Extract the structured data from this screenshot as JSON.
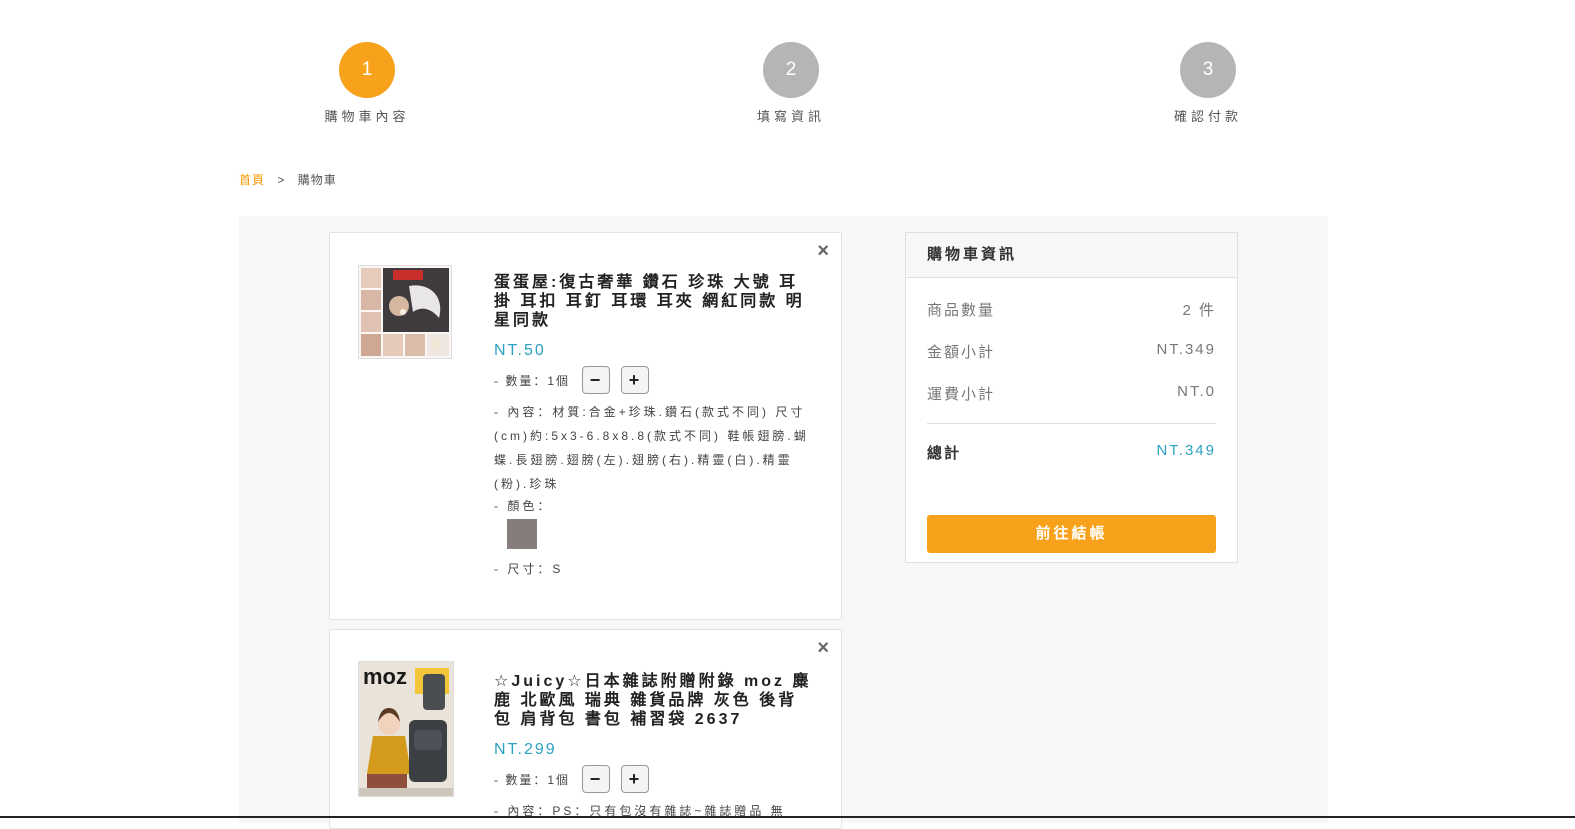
{
  "steps": [
    {
      "number": "1",
      "label": "購物車內容",
      "active": true
    },
    {
      "number": "2",
      "label": "填寫資訊",
      "active": false
    },
    {
      "number": "3",
      "label": "確認付款",
      "active": false
    }
  ],
  "breadcrumb": {
    "home": "首頁",
    "separator": ">",
    "current": "購物車"
  },
  "items": [
    {
      "close": "×",
      "title": "蛋蛋屋:復古奢華 鑽石 珍珠 大號 耳掛 耳扣 耳釘 耳環 耳夾 網紅同款 明星同款",
      "price": "NT.50",
      "qty_label": "- 數量：1個",
      "minus": "−",
      "plus": "+",
      "content": "- 內容：材質:合金+珍珠.鑽石(款式不同) 尺寸(cm)約:5x3-6.8x8.8(款式不同) 鞋帳翅膀.蝴蝶.長翅膀.翅膀(左).翅膀(右).精靈(白).精靈(粉).珍珠",
      "color_label": "- 顏色：",
      "color_swatch": "#857c7b",
      "size_label": "- 尺寸：S",
      "image_alt": "蛋蛋屋"
    },
    {
      "close": "×",
      "title": "☆Juicy☆日本雜誌附贈附錄 moz 麋鹿 北歐風 瑞典 雜貨品牌 灰色 後背包 肩背包 書包 補習袋 2637",
      "price": "NT.299",
      "qty_label": "- 數量：1個",
      "minus": "−",
      "plus": "+",
      "content": "- 內容：PS：只有包沒有雜誌~雜誌贈品 無",
      "image_logo": "moz"
    }
  ],
  "summary": {
    "title": "購物車資訊",
    "qty_label": "商品數量",
    "qty_value": "2 件",
    "subtotal_label": "金額小計",
    "subtotal_value": "NT.349",
    "shipping_label": "運費小計",
    "shipping_value": "NT.0",
    "total_label": "總計",
    "total_value": "NT.349",
    "checkout_label": "前往結帳"
  },
  "colors": {
    "accent": "#f8a11a",
    "price": "#2aa1c0",
    "inactive_step": "#b5b5b5"
  }
}
